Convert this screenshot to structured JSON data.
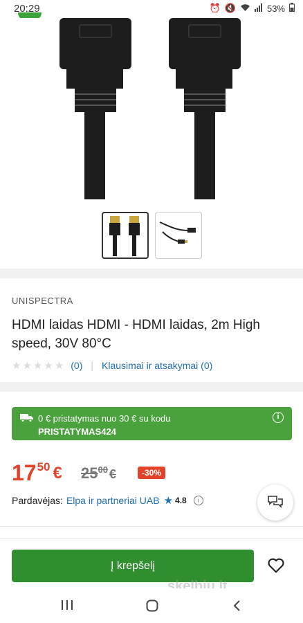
{
  "status_bar": {
    "time": "20:29",
    "battery": "53%",
    "icons": [
      "alarm-icon",
      "mute-icon",
      "wifi-icon",
      "signal-icon",
      "battery-icon"
    ]
  },
  "gallery": {
    "thumbnails": [
      "hdmi-cable-pair",
      "hdmi-cable-coil"
    ]
  },
  "product": {
    "brand": "UNISPECTRA",
    "title": "HDMI laidas HDMI - HDMI laidas, 2m High speed, 30V 80°C",
    "rating_count": "(0)",
    "questions_link": "Klausimai ir atsakymai (0)",
    "stars": 0
  },
  "promo": {
    "text": "0 € pristatymas nuo 30 € su kodu",
    "code": "PRISTATYMAS424"
  },
  "price": {
    "current_int": "17",
    "current_cents": "50",
    "currency": "€",
    "old_int": "25",
    "old_cents": "00",
    "discount": "-30%"
  },
  "seller": {
    "label": "Pardavėjas:",
    "name": "Elpa ir partneriai UAB",
    "rating": "4.8"
  },
  "actions": {
    "add_to_cart": "Į krepšelį"
  },
  "watermark": "skelbiu.lt",
  "colors": {
    "green": "#2f8f2f",
    "promo_green": "#4aa23c",
    "price_red": "#e2432a",
    "link_blue": "#1f6fb5"
  }
}
